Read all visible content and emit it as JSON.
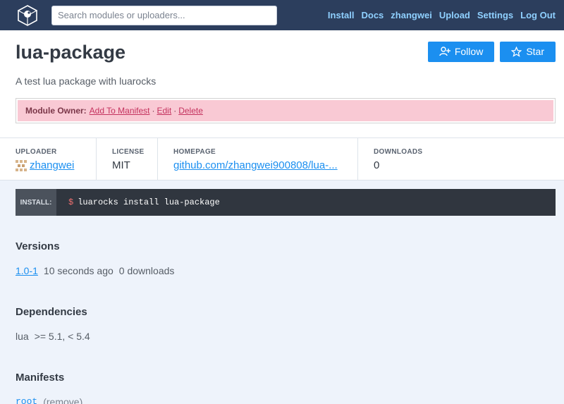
{
  "nav": {
    "search_placeholder": "Search modules or uploaders...",
    "links": [
      "Install",
      "Docs",
      "zhangwei",
      "Upload",
      "Settings",
      "Log Out"
    ]
  },
  "module": {
    "title": "lua-package",
    "summary": "A test lua package with luarocks",
    "follow_label": "Follow",
    "star_label": "Star"
  },
  "owner_bar": {
    "label": "Module Owner:",
    "actions": [
      "Add To Manifest",
      "Edit",
      "Delete"
    ],
    "separator": "·"
  },
  "meta": {
    "uploader": {
      "heading": "UPLOADER",
      "value": "zhangwei"
    },
    "license": {
      "heading": "LICENSE",
      "value": "MIT"
    },
    "homepage": {
      "heading": "HOMEPAGE",
      "value": "github.com/zhangwei900808/lua-..."
    },
    "downloads": {
      "heading": "DOWNLOADS",
      "value": "0"
    }
  },
  "install": {
    "label": "INSTALL:",
    "prompt": "$",
    "command": "luarocks install lua-package"
  },
  "versions": {
    "heading": "Versions",
    "items": [
      {
        "version": "1.0-1",
        "age": "10 seconds ago",
        "downloads": "0 downloads"
      }
    ]
  },
  "dependencies": {
    "heading": "Dependencies",
    "items": [
      {
        "name": "lua",
        "constraint": ">= 5.1, < 5.4"
      }
    ]
  },
  "manifests": {
    "heading": "Manifests",
    "items": [
      {
        "name": "root",
        "remove_prefix": "(",
        "remove_label": "remove",
        "remove_suffix": ")"
      }
    ]
  },
  "colors": {
    "header_bg": "#2c3e5d",
    "nav_link": "#8fd0ff",
    "accent": "#1b8ff0",
    "owner_bg": "#f9c9d4",
    "install_bg": "#30363f"
  }
}
